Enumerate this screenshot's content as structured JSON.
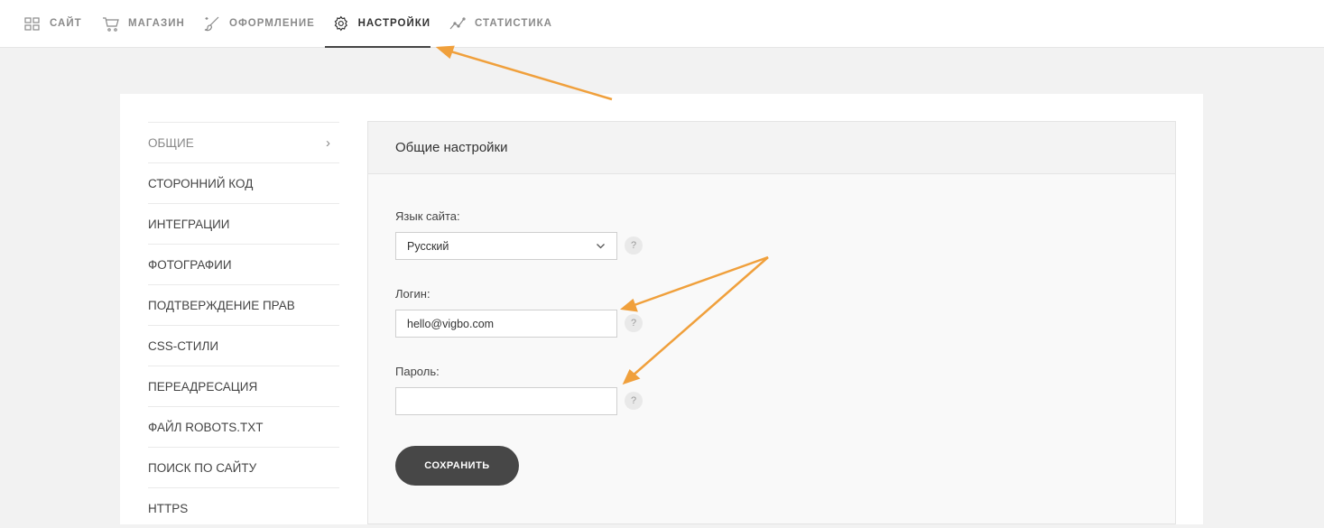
{
  "topnav": {
    "items": [
      {
        "label": "САЙТ",
        "icon": "grid-icon"
      },
      {
        "label": "МАГАЗИН",
        "icon": "cart-icon"
      },
      {
        "label": "ОФОРМЛЕНИЕ",
        "icon": "brush-icon"
      },
      {
        "label": "НАСТРОЙКИ",
        "icon": "gear-icon",
        "active": true
      },
      {
        "label": "СТАТИСТИКА",
        "icon": "chart-icon"
      }
    ]
  },
  "sidebar": {
    "items": [
      {
        "label": "ОБЩИЕ",
        "active": true
      },
      {
        "label": "СТОРОННИЙ КОД"
      },
      {
        "label": "ИНТЕГРАЦИИ"
      },
      {
        "label": "ФОТОГРАФИИ"
      },
      {
        "label": "ПОДТВЕРЖДЕНИЕ ПРАВ"
      },
      {
        "label": "CSS-СТИЛИ"
      },
      {
        "label": "ПЕРЕАДРЕСАЦИЯ"
      },
      {
        "label": "ФАЙЛ ROBOTS.TXT"
      },
      {
        "label": "ПОИСК ПО САЙТУ"
      },
      {
        "label": "HTTPS"
      }
    ]
  },
  "panel": {
    "title": "Общие настройки",
    "language": {
      "label": "Язык сайта:",
      "value": "Русский"
    },
    "login": {
      "label": "Логин:",
      "value": "hello@vigbo.com"
    },
    "password": {
      "label": "Пароль:",
      "value": ""
    },
    "help_symbol": "?",
    "save_label": "СОХРАНИТЬ"
  },
  "colors": {
    "annotation_arrow": "#f0a03c",
    "button": "#474747",
    "background": "#f2f2f2"
  }
}
